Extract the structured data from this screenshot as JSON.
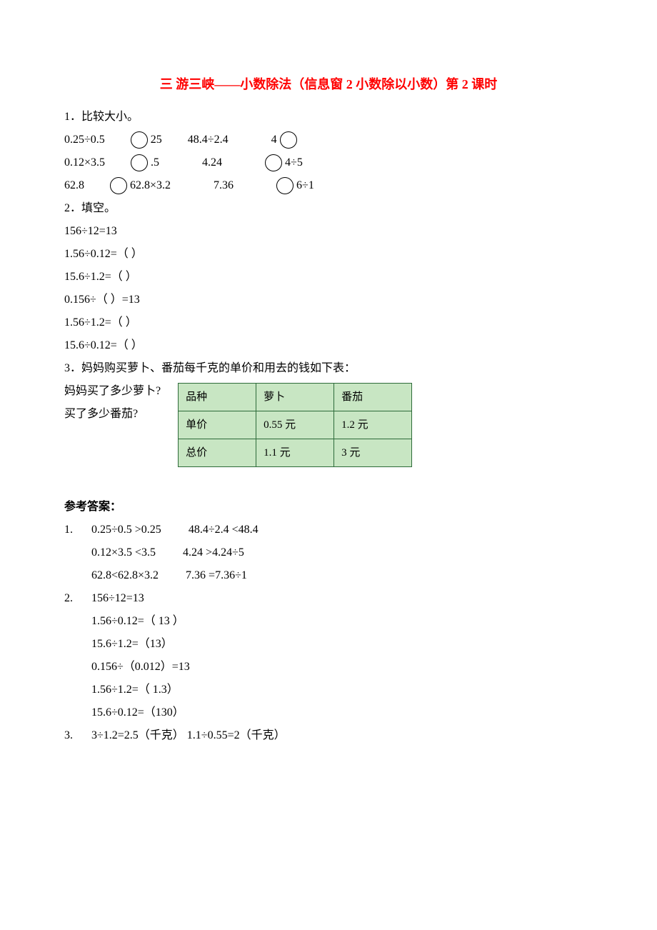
{
  "title": "三 游三峡——小数除法（信息窗 2 小数除以小数）第 2 课时",
  "q1": {
    "heading": "1．比较大小。",
    "r1a_left": "0.25÷0.5",
    "r1a_right": "25",
    "r1b_left": "48.4÷2.4",
    "r1b_right": "4",
    "r2a_left": "0.12×3.5",
    "r2a_right": ".5",
    "r2b_left": "4.24",
    "r2b_right": "4÷5",
    "r3a_left": "62.8",
    "r3a_right": "62.8×3.2",
    "r3b_left": "7.36",
    "r3b_right": "6÷1"
  },
  "q2": {
    "heading": "2．填空。",
    "l1": "156÷12=13",
    "l2": "1.56÷0.12=（    ）",
    "l3": "15.6÷1.2=（    ）",
    "l4": "0.156÷（    ）=13",
    "l5": "1.56÷1.2=（    ）",
    "l6": "15.6÷0.12=（    ）"
  },
  "q3": {
    "heading": "3．妈妈购买萝卜、番茄每千克的单价和用去的钱如下表：",
    "ask1": "妈妈买了多少萝卜?",
    "ask2": "买了多少番茄?",
    "table": {
      "h1": "品种",
      "h2": "萝卜",
      "h3": "番茄",
      "r2c1": "单价",
      "r2c2": "0.55 元",
      "r2c3": "1.2 元",
      "r3c1": "总价",
      "r3c2": "1.1 元",
      "r3c3": "3 元"
    }
  },
  "answers": {
    "heading": "参考答案：",
    "a1": {
      "num": "1.",
      "l1a": "0.25÷0.5 >0.25",
      "l1b": "48.4÷2.4 <48.4",
      "l2a": "0.12×3.5 <3.5",
      "l2b": "4.24 >4.24÷5",
      "l3a": "62.8<62.8×3.2",
      "l3b": "7.36 =7.36÷1"
    },
    "a2": {
      "num": "2.",
      "l1": "156÷12=13",
      "l2": "1.56÷0.12=（ 13 ）",
      "l3": "15.6÷1.2=（13）",
      "l4": "0.156÷（0.012）=13",
      "l5": "1.56÷1.2=（ 1.3）",
      "l6": "15.6÷0.12=（130）"
    },
    "a3": {
      "num": "3.",
      "text": "3÷1.2=2.5（千克）  1.1÷0.55=2（千克）"
    }
  }
}
